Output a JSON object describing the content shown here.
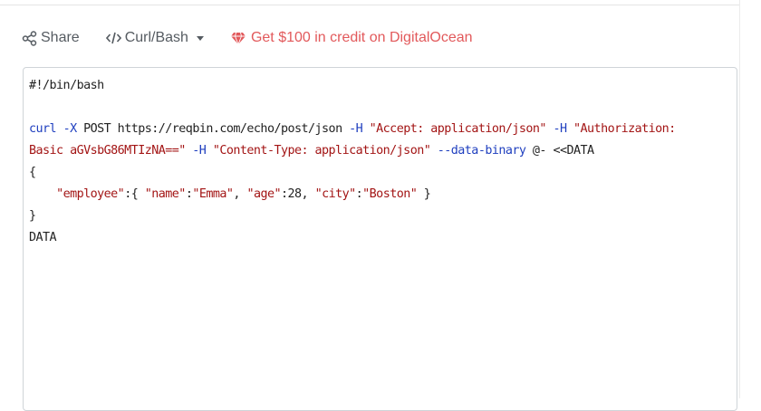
{
  "toolbar": {
    "share_label": "Share",
    "language_label": "Curl/Bash",
    "promo_label": "Get $100 in credit on DigitalOcean"
  },
  "colors": {
    "toolbar_text": "#555b61",
    "promo": "#e2595b",
    "keyword": "#1f3fbf",
    "string": "#a31515",
    "editor_border": "#cfd4d8"
  },
  "icons": {
    "share": "share-icon",
    "language": "code-icon",
    "dropdown": "caret-down-icon",
    "promo": "gem-icon"
  },
  "code": {
    "shebang": "#!/bin/bash",
    "curl_cmd": "curl",
    "flag_x": "-X",
    "method_url": "POST https://reqbin.com/echo/post/json",
    "flag_h1": "-H",
    "header_accept": "\"Accept: application/json\"",
    "flag_h2": "-H",
    "header_auth_part1": "\"Authorization:",
    "header_auth_part2": "Basic aGVsbG86MTIzNA==\"",
    "flag_h3": "-H",
    "header_content_type": "\"Content-Type: application/json\"",
    "flag_data": "--data-binary",
    "heredoc_start": "@- <<DATA",
    "brace_open": "{",
    "indent": "    ",
    "key_employee": "\"employee\"",
    "json_mid1": ":{ ",
    "key_name": "\"name\"",
    "colon1": ":",
    "val_name": "\"Emma\"",
    "comma1": ", ",
    "key_age": "\"age\"",
    "colon_age": ":28, ",
    "key_city": "\"city\"",
    "colon2": ":",
    "val_city": "\"Boston\"",
    "json_end": " }",
    "brace_close": "}",
    "heredoc_end": "DATA"
  }
}
